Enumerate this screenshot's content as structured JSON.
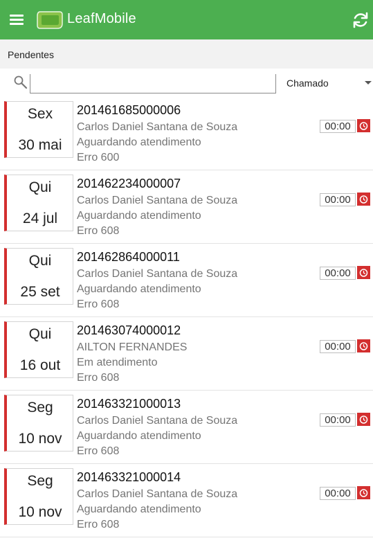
{
  "appbar": {
    "title": "LeafMobile",
    "brand_color": "#4caf50",
    "menu_icon": "hamburger-menu-icon",
    "logo_icon": "leaf-logo-icon",
    "refresh_icon": "refresh-icon"
  },
  "subheader": {
    "title": "Pendentes"
  },
  "search": {
    "value": "",
    "placeholder": "",
    "icon": "search-icon"
  },
  "filter": {
    "selected": "Chamado"
  },
  "accent_color": "#d32f2f",
  "tickets": [
    {
      "day": "Sex",
      "date": "30 mai",
      "id": "201461685000006",
      "person": "Carlos Daniel Santana de Souza",
      "status": "Aguardando atendimento",
      "error": "Erro 600",
      "timer": "00:00"
    },
    {
      "day": "Qui",
      "date": "24 jul",
      "id": "201462234000007",
      "person": "Carlos Daniel Santana de Souza",
      "status": "Aguardando atendimento",
      "error": "Erro 608",
      "timer": "00:00"
    },
    {
      "day": "Qui",
      "date": "25 set",
      "id": "201462864000011",
      "person": "Carlos Daniel Santana de Souza",
      "status": "Aguardando atendimento",
      "error": "Erro 608",
      "timer": "00:00"
    },
    {
      "day": "Qui",
      "date": "16 out",
      "id": "201463074000012",
      "person": "AILTON FERNANDES",
      "status": "Em atendimento",
      "error": "Erro 608",
      "timer": "00:00"
    },
    {
      "day": "Seg",
      "date": "10 nov",
      "id": "201463321000013",
      "person": "Carlos Daniel Santana de Souza",
      "status": "Aguardando atendimento",
      "error": "Erro 608",
      "timer": "00:00"
    },
    {
      "day": "Seg",
      "date": "10 nov",
      "id": "201463321000014",
      "person": "Carlos Daniel Santana de Souza",
      "status": "Aguardando atendimento",
      "error": "Erro 608",
      "timer": "00:00"
    }
  ]
}
